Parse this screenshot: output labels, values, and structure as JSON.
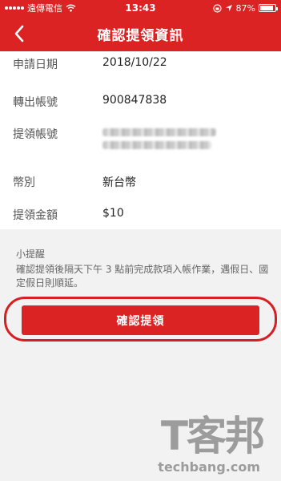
{
  "status_bar": {
    "carrier": "遠傳電信",
    "time": "13:43",
    "battery": "87%",
    "battery_level": 0.87
  },
  "nav": {
    "title": "確認提領資訊"
  },
  "details": [
    {
      "label": "申請日期",
      "value": "2018/10/22"
    },
    {
      "label": "轉出帳號",
      "value": "900847838"
    },
    {
      "label": "提領帳號",
      "value": ""
    },
    {
      "label": "幣別",
      "value": "新台幣"
    },
    {
      "label": "提領金額",
      "value": "$10"
    }
  ],
  "notice": {
    "title": "小提醒",
    "body": "確認提領後隔天下午 3 點前完成款項入帳作業，遇假日、國定假日則順延。"
  },
  "confirm_button": {
    "label": "確認提領"
  },
  "watermark": {
    "text_cn": "T客邦",
    "text_en": "techbang.com"
  },
  "colors": {
    "brand_red": "#dc2323",
    "highlight_ring": "#d42020"
  }
}
